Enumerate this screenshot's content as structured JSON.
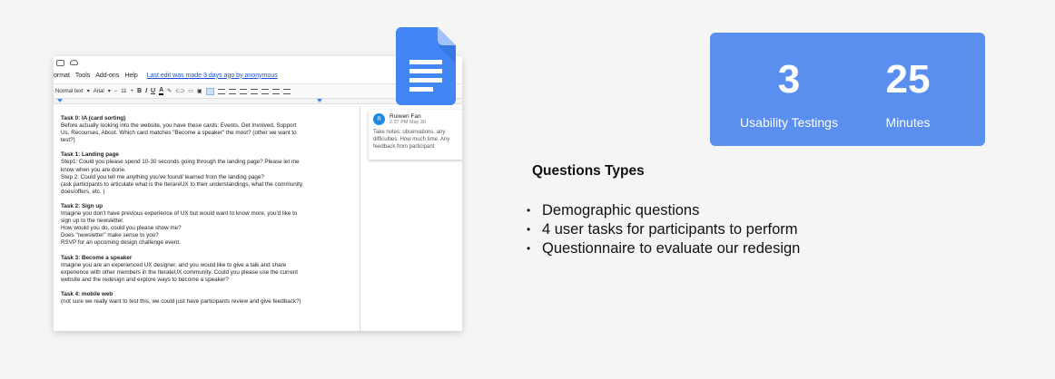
{
  "doc": {
    "menus": [
      "ormat",
      "Tools",
      "Add-ons",
      "Help"
    ],
    "last_edit": "Last edit was made 3 days ago by anonymous",
    "toolbar": {
      "style": "Normal text",
      "font": "Arial",
      "minus": "−",
      "size": "11",
      "plus": "+",
      "bold": "B",
      "italic": "I",
      "underline": "U",
      "color": "A"
    },
    "tasks": [
      {
        "title": "Task 0: IA (card sorting)",
        "lines": [
          "Before actually looking into the website, you have these cards: Events, Get Involved, Support",
          "Us, Recourses, About. Which card matches \"Become a speaker\" the most? (other we want to",
          "test?)"
        ]
      },
      {
        "title": "Task 1: Landing page",
        "lines": [
          "Step1: Could you please spend 10-30 seconds going through the landing page? Please let me",
          "know when you are done.",
          "Step 2: Could you tell me anything you've found/ learned from the landing page?",
          "(ask participants to articulate what is the IterareUX to their understandings, what the community",
          "does/offers, etc. )"
        ]
      },
      {
        "title": "Task 2: Sign up",
        "lines": [
          "Imagine you don't have previous experience of UX but would want to know more, you'd like to",
          "sign up to the newsletter.",
          "How would you do, could you please show me?",
          "Does \"newsletter\" make sense to you?",
          "RSVP for an upcoming design challenge event."
        ]
      },
      {
        "title": "Task 3: Become a speaker",
        "lines": [
          "Imagine you are an experienced UX designer, and you would like to give a talk and share",
          "experience with other members in the IterateUX community. Could you please use the current",
          "website and the redesign and explore ways  to become a speaker?"
        ]
      },
      {
        "title": "Task 4: mobile web",
        "lines": [
          "(not sure we really want to test this, we could just have participants review and give feedback?)"
        ]
      }
    ],
    "comment": {
      "avatar_letter": "R",
      "author": "Ruiwen Fan",
      "time": "2:37 PM May 30",
      "text": "Take notes: observations. any difficulties. How much time. Any feedback from participant"
    }
  },
  "stats": [
    {
      "number": "3",
      "label": "Usability Testings"
    },
    {
      "number": "25",
      "label": "Minutes"
    }
  ],
  "questions": {
    "title": "Questions Types",
    "items": [
      "Demographic questions",
      "4 user tasks for participants to perform",
      "Questionnaire to evaluate our redesign"
    ]
  },
  "colors": {
    "stats_bg": "#5a8ff0",
    "gdocs_blue": "#4285f4",
    "background": "#f5f5f5"
  }
}
